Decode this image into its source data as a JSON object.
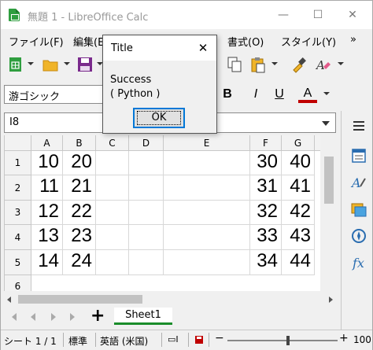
{
  "window": {
    "title": "無題 1 - LibreOffice Calc",
    "minimize": "—",
    "maximize": "☐",
    "close": "✕"
  },
  "menu": [
    "ファイル(F)",
    "編集(E)",
    "書式(O)",
    "スタイル(Y)"
  ],
  "menu_overflow": "»",
  "font": {
    "name": "游ゴシック"
  },
  "format": {
    "bold": "B",
    "italic": "I",
    "underline": "U",
    "font_color": "A",
    "font_color_hex": "#c00000"
  },
  "namebox": {
    "value": "I8"
  },
  "columns": [
    "A",
    "B",
    "C",
    "D",
    "E",
    "F",
    "G"
  ],
  "rows": [
    {
      "num": "1",
      "A": "10",
      "B": "20",
      "F": "30",
      "G": "40"
    },
    {
      "num": "2",
      "A": "11",
      "B": "21",
      "F": "31",
      "G": "41"
    },
    {
      "num": "3",
      "A": "12",
      "B": "22",
      "F": "32",
      "G": "42"
    },
    {
      "num": "4",
      "A": "13",
      "B": "23",
      "F": "33",
      "G": "43"
    },
    {
      "num": "5",
      "A": "14",
      "B": "24",
      "F": "34",
      "G": "44"
    },
    {
      "num": "6"
    }
  ],
  "sheet": {
    "add": "+",
    "tab": "Sheet1"
  },
  "status": {
    "sheet": "シート 1 / 1",
    "style": "標準",
    "language": "英語 (米国)",
    "zoom": "100"
  },
  "dialog": {
    "title": "Title",
    "close": "✕",
    "message_line1": "Success",
    "message_line2": "( Python )",
    "ok": "OK"
  },
  "colors": {
    "accent_green": "#1a8d2a",
    "dialog_focus": "#0078d7"
  }
}
